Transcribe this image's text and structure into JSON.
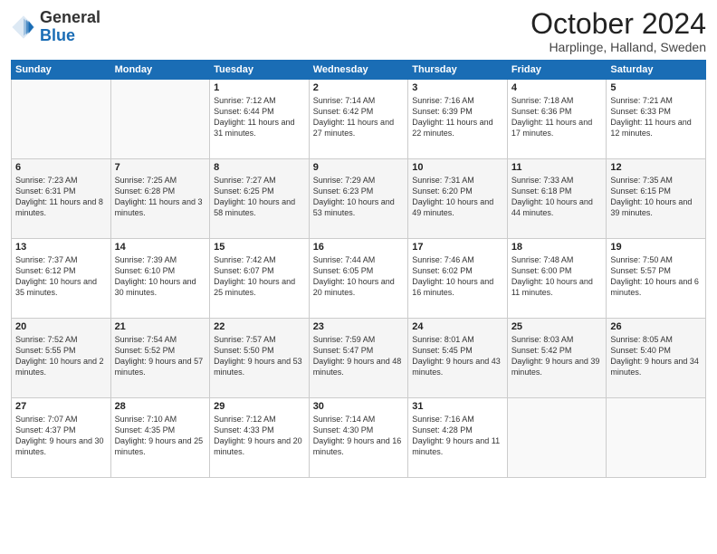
{
  "logo": {
    "general": "General",
    "blue": "Blue"
  },
  "title": {
    "month": "October 2024",
    "location": "Harplinge, Halland, Sweden"
  },
  "days_header": [
    "Sunday",
    "Monday",
    "Tuesday",
    "Wednesday",
    "Thursday",
    "Friday",
    "Saturday"
  ],
  "weeks": [
    [
      {
        "day": "",
        "text": ""
      },
      {
        "day": "",
        "text": ""
      },
      {
        "day": "1",
        "text": "Sunrise: 7:12 AM\nSunset: 6:44 PM\nDaylight: 11 hours and 31 minutes."
      },
      {
        "day": "2",
        "text": "Sunrise: 7:14 AM\nSunset: 6:42 PM\nDaylight: 11 hours and 27 minutes."
      },
      {
        "day": "3",
        "text": "Sunrise: 7:16 AM\nSunset: 6:39 PM\nDaylight: 11 hours and 22 minutes."
      },
      {
        "day": "4",
        "text": "Sunrise: 7:18 AM\nSunset: 6:36 PM\nDaylight: 11 hours and 17 minutes."
      },
      {
        "day": "5",
        "text": "Sunrise: 7:21 AM\nSunset: 6:33 PM\nDaylight: 11 hours and 12 minutes."
      }
    ],
    [
      {
        "day": "6",
        "text": "Sunrise: 7:23 AM\nSunset: 6:31 PM\nDaylight: 11 hours and 8 minutes."
      },
      {
        "day": "7",
        "text": "Sunrise: 7:25 AM\nSunset: 6:28 PM\nDaylight: 11 hours and 3 minutes."
      },
      {
        "day": "8",
        "text": "Sunrise: 7:27 AM\nSunset: 6:25 PM\nDaylight: 10 hours and 58 minutes."
      },
      {
        "day": "9",
        "text": "Sunrise: 7:29 AM\nSunset: 6:23 PM\nDaylight: 10 hours and 53 minutes."
      },
      {
        "day": "10",
        "text": "Sunrise: 7:31 AM\nSunset: 6:20 PM\nDaylight: 10 hours and 49 minutes."
      },
      {
        "day": "11",
        "text": "Sunrise: 7:33 AM\nSunset: 6:18 PM\nDaylight: 10 hours and 44 minutes."
      },
      {
        "day": "12",
        "text": "Sunrise: 7:35 AM\nSunset: 6:15 PM\nDaylight: 10 hours and 39 minutes."
      }
    ],
    [
      {
        "day": "13",
        "text": "Sunrise: 7:37 AM\nSunset: 6:12 PM\nDaylight: 10 hours and 35 minutes."
      },
      {
        "day": "14",
        "text": "Sunrise: 7:39 AM\nSunset: 6:10 PM\nDaylight: 10 hours and 30 minutes."
      },
      {
        "day": "15",
        "text": "Sunrise: 7:42 AM\nSunset: 6:07 PM\nDaylight: 10 hours and 25 minutes."
      },
      {
        "day": "16",
        "text": "Sunrise: 7:44 AM\nSunset: 6:05 PM\nDaylight: 10 hours and 20 minutes."
      },
      {
        "day": "17",
        "text": "Sunrise: 7:46 AM\nSunset: 6:02 PM\nDaylight: 10 hours and 16 minutes."
      },
      {
        "day": "18",
        "text": "Sunrise: 7:48 AM\nSunset: 6:00 PM\nDaylight: 10 hours and 11 minutes."
      },
      {
        "day": "19",
        "text": "Sunrise: 7:50 AM\nSunset: 5:57 PM\nDaylight: 10 hours and 6 minutes."
      }
    ],
    [
      {
        "day": "20",
        "text": "Sunrise: 7:52 AM\nSunset: 5:55 PM\nDaylight: 10 hours and 2 minutes."
      },
      {
        "day": "21",
        "text": "Sunrise: 7:54 AM\nSunset: 5:52 PM\nDaylight: 9 hours and 57 minutes."
      },
      {
        "day": "22",
        "text": "Sunrise: 7:57 AM\nSunset: 5:50 PM\nDaylight: 9 hours and 53 minutes."
      },
      {
        "day": "23",
        "text": "Sunrise: 7:59 AM\nSunset: 5:47 PM\nDaylight: 9 hours and 48 minutes."
      },
      {
        "day": "24",
        "text": "Sunrise: 8:01 AM\nSunset: 5:45 PM\nDaylight: 9 hours and 43 minutes."
      },
      {
        "day": "25",
        "text": "Sunrise: 8:03 AM\nSunset: 5:42 PM\nDaylight: 9 hours and 39 minutes."
      },
      {
        "day": "26",
        "text": "Sunrise: 8:05 AM\nSunset: 5:40 PM\nDaylight: 9 hours and 34 minutes."
      }
    ],
    [
      {
        "day": "27",
        "text": "Sunrise: 7:07 AM\nSunset: 4:37 PM\nDaylight: 9 hours and 30 minutes."
      },
      {
        "day": "28",
        "text": "Sunrise: 7:10 AM\nSunset: 4:35 PM\nDaylight: 9 hours and 25 minutes."
      },
      {
        "day": "29",
        "text": "Sunrise: 7:12 AM\nSunset: 4:33 PM\nDaylight: 9 hours and 20 minutes."
      },
      {
        "day": "30",
        "text": "Sunrise: 7:14 AM\nSunset: 4:30 PM\nDaylight: 9 hours and 16 minutes."
      },
      {
        "day": "31",
        "text": "Sunrise: 7:16 AM\nSunset: 4:28 PM\nDaylight: 9 hours and 11 minutes."
      },
      {
        "day": "",
        "text": ""
      },
      {
        "day": "",
        "text": ""
      }
    ]
  ]
}
